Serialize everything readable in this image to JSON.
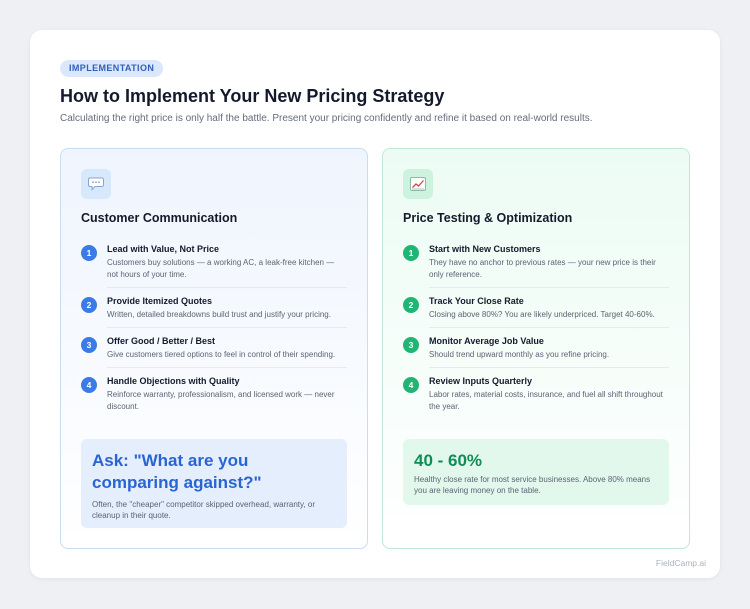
{
  "header": {
    "tag": "IMPLEMENTATION",
    "title": "How to Implement Your New Pricing Strategy",
    "subtitle": "Calculating the right price is only half the battle. Present your pricing confidently and refine it based on real-world results."
  },
  "left_panel": {
    "icon": "speech-bubble-icon",
    "title": "Customer Communication",
    "items": [
      {
        "num": "1",
        "title": "Lead with Value, Not Price",
        "desc": "Customers buy solutions — a working AC, a leak-free kitchen — not hours of your time."
      },
      {
        "num": "2",
        "title": "Provide Itemized Quotes",
        "desc": "Written, detailed breakdowns build trust and justify your pricing."
      },
      {
        "num": "3",
        "title": "Offer Good / Better / Best",
        "desc": "Give customers tiered options to feel in control of their spending."
      },
      {
        "num": "4",
        "title": "Handle Objections with Quality",
        "desc": "Reinforce warranty, professionalism, and licensed work — never discount."
      }
    ],
    "callout": {
      "big": "Ask: \"What are you comparing against?\"",
      "small": "Often, the \"cheaper\" competitor skipped overhead, warranty, or cleanup in their quote."
    }
  },
  "right_panel": {
    "icon": "chart-trend-icon",
    "title": "Price Testing & Optimization",
    "items": [
      {
        "num": "1",
        "title": "Start with New Customers",
        "desc": "They have no anchor to previous rates — your new price is their only reference."
      },
      {
        "num": "2",
        "title": "Track Your Close Rate",
        "desc": "Closing above 80%? You are likely underpriced. Target 40-60%."
      },
      {
        "num": "3",
        "title": "Monitor Average Job Value",
        "desc": "Should trend upward monthly as you refine pricing."
      },
      {
        "num": "4",
        "title": "Review Inputs Quarterly",
        "desc": "Labor rates, material costs, insurance, and fuel all shift throughout the year."
      }
    ],
    "callout": {
      "big": "40 - 60%",
      "small": "Healthy close rate for most service businesses. Above 80% means you are leaving money on the table."
    }
  },
  "footer": {
    "brand": "FieldCamp.ai"
  },
  "colors": {
    "blue_accent": "#3b7be8",
    "green_accent": "#1fb574",
    "callout_blue_text": "#2a64d3",
    "callout_green_text": "#0f8d57"
  }
}
